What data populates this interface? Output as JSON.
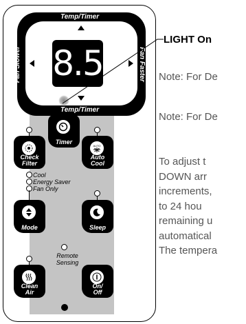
{
  "display": {
    "value": "8.5"
  },
  "dial_labels": {
    "top": "Temp/Timer",
    "bottom": "Temp/Timer",
    "left": "Fan Slower",
    "right": "Fan Faster"
  },
  "buttons": {
    "timer": "Timer",
    "check_filter": [
      "Check",
      "Filter"
    ],
    "auto_cool": [
      "Auto",
      "Cool"
    ],
    "auto_badge": "AUTO",
    "mode": "Mode",
    "sleep": "Sleep",
    "clean_air": [
      "Clean",
      "Air"
    ],
    "on_off": [
      "On/",
      "Off"
    ]
  },
  "modes": [
    "Cool",
    "Energy Saver",
    "Fan Only"
  ],
  "remote_sensing": [
    "Remote",
    "Sensing"
  ],
  "callout": "LIGHT On",
  "notes": [
    "Note: For De",
    "Note: For De"
  ],
  "paragraph": [
    "To  adjust  t",
    "DOWN  arr",
    "increments,",
    "to  24  hou",
    "remaining u",
    "automatical",
    "The tempera"
  ],
  "colors": {
    "panel": "#000000",
    "strip": "#c4c4c4",
    "body_text": "#555555"
  }
}
